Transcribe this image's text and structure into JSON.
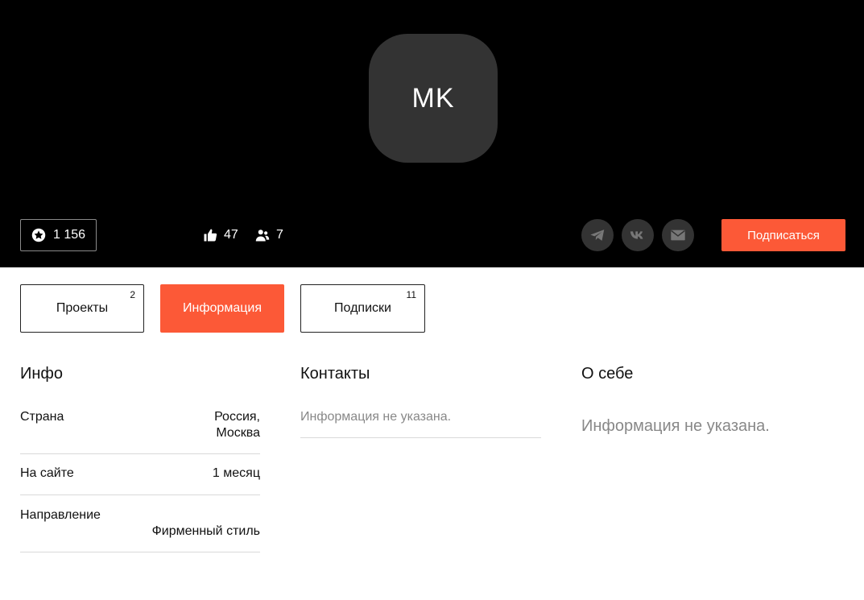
{
  "profile": {
    "initials": "MK",
    "rating": "1 156",
    "likes": "47",
    "followers": "7",
    "subscribe_label": "Подписаться"
  },
  "social": {
    "icons": [
      "telegram-icon",
      "vk-icon",
      "mail-icon"
    ]
  },
  "tabs": [
    {
      "label": "Проекты",
      "count": "2"
    },
    {
      "label": "Информация",
      "count": ""
    },
    {
      "label": "Подписки",
      "count": "11"
    }
  ],
  "info": {
    "title": "Инфо",
    "rows": [
      {
        "label": "Страна",
        "value": "Россия, Москва"
      },
      {
        "label": "На сайте",
        "value": "1 месяц"
      },
      {
        "label": "Направление",
        "value": "Фирменный стиль"
      }
    ]
  },
  "contacts": {
    "title": "Контакты",
    "empty_text": "Информация не указана."
  },
  "about": {
    "title": "О себе",
    "empty_text": "Информация не указана."
  },
  "colors": {
    "accent": "#fc5937",
    "header_bg": "#000000",
    "avatar_bg": "#333333",
    "muted_text": "#888888"
  }
}
